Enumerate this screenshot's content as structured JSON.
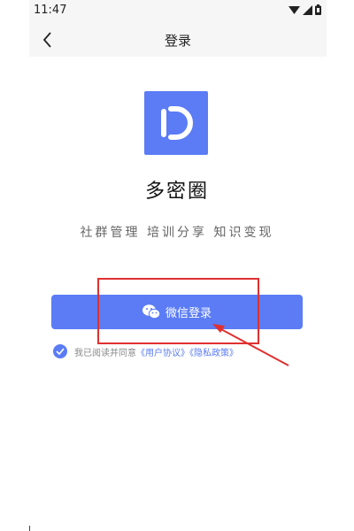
{
  "status_bar": {
    "time": "11:47",
    "icons": [
      "wifi-icon",
      "signal-icon",
      "battery-icon"
    ]
  },
  "nav": {
    "back_icon": "chevron-left-icon",
    "title": "登录"
  },
  "app": {
    "logo_letter": "D",
    "name": "多密圈",
    "slogan": "社群管理 培训分享 知识变现"
  },
  "login": {
    "wechat_icon": "wechat-icon",
    "wechat_label": "微信登录"
  },
  "agreement": {
    "checked": true,
    "prefix": "我已阅读并同意",
    "user_agreement": "《用户协议》",
    "privacy_policy": "《隐私政策》"
  },
  "colors": {
    "accent": "#5b7cf5",
    "annotation": "#e03030"
  }
}
